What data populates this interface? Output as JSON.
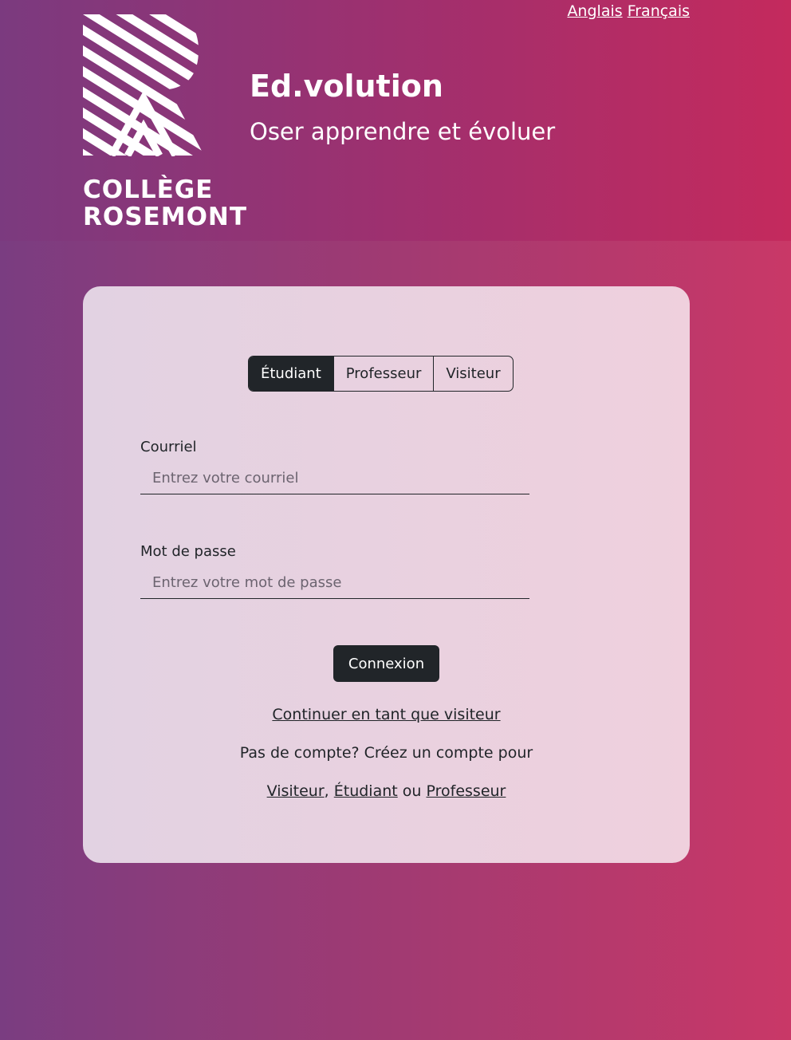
{
  "language_links": {
    "english": "Anglais",
    "french": "Français"
  },
  "logo": {
    "line1": "COLLÈGE",
    "line2": "ROSEMONT"
  },
  "brand": {
    "title": "Ed.volution",
    "tagline": "Oser apprendre et évoluer"
  },
  "role_tabs": [
    {
      "label": "Étudiant",
      "active": true
    },
    {
      "label": "Professeur",
      "active": false
    },
    {
      "label": "Visiteur",
      "active": false
    }
  ],
  "form": {
    "email_label": "Courriel",
    "email_placeholder": "Entrez votre courriel",
    "password_label": "Mot de passe",
    "password_placeholder": "Entrez votre mot de passe",
    "submit_label": "Connexion"
  },
  "links": {
    "continue_visitor": "Continuer en tant que visiteur",
    "no_account_text": "Pas de compte? Créez un compte pour",
    "signup_visitor": "Visiteur",
    "comma": ",",
    "signup_student": "Étudiant",
    "or_text": "ou",
    "signup_teacher": "Professeur"
  },
  "colors": {
    "dark": "#212529",
    "gradient_start": "#7a3d81",
    "gradient_end": "#c93867",
    "card_bg": "#e8d1df"
  }
}
